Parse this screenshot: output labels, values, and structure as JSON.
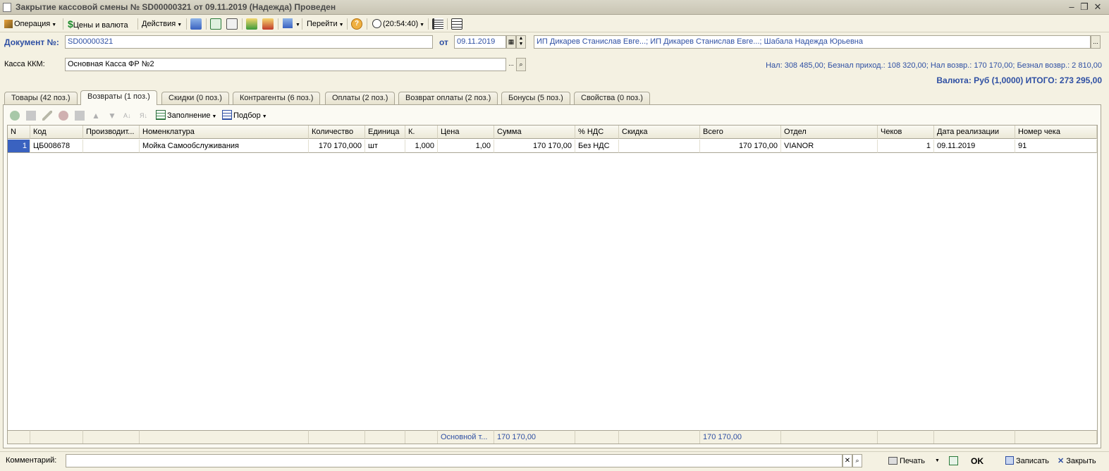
{
  "window": {
    "title": "Закрытие кассовой смены № SD00000321 от 09.11.2019 (Надежда) Проведен"
  },
  "toolbar": {
    "operation": "Операция",
    "prices_currency": "Цены и валюта",
    "actions": "Действия",
    "goto": "Перейти",
    "time": "(20:54:40)"
  },
  "doc": {
    "number_label": "Документ №:",
    "number_value": "SD00000321",
    "date_label": "от",
    "date_value": "09.11.2019",
    "org_value": "ИП Дикарев Станислав Евге...; ИП Дикарев Станислав Евге...; Шабала Надежда Юрьевна",
    "kkm_label": "Касса ККМ:",
    "kkm_value": "Основная Касса ФР №2",
    "totals_line": "Нал: 308 485,00; Безнал приход.: 108 320,00; Нал возвр.: 170 170,00; Безнал возвр.: 2 810,00",
    "currency_total": "Валюта: Руб (1,0000) ИТОГО: 273 295,00"
  },
  "tabs": [
    "Товары (42 поз.)",
    "Возвраты (1 поз.)",
    "Скидки (0 поз.)",
    "Контрагенты (6 поз.)",
    "Оплаты (2 поз.)",
    "Возврат оплаты (2 поз.)",
    "Бонусы (5 поз.)",
    "Свойства (0 поз.)"
  ],
  "grid_toolbar": {
    "fill": "Заполнение",
    "pick": "Подбор"
  },
  "table": {
    "columns": [
      "N",
      "Код",
      "Производит...",
      "Номенклатура",
      "Количество",
      "Единица",
      "К.",
      "Цена",
      "Сумма",
      "% НДС",
      "Скидка",
      "Всего",
      "Отдел",
      "Чеков",
      "Дата реализации",
      "Номер чека"
    ],
    "rows": [
      [
        "1",
        "ЦБ008678",
        "",
        "Мойка Самообслуживания",
        "170 170,000",
        "шт",
        "1,000",
        "1,00",
        "170 170,00",
        "Без НДС",
        "",
        "170 170,00",
        "VIANOR",
        "1",
        "09.11.2019",
        "91"
      ]
    ],
    "footer": {
      "price": "Основной т...",
      "sum": "170 170,00",
      "total": "170 170,00"
    }
  },
  "footer": {
    "comment_label": "Комментарий:",
    "comment_value": "",
    "print": "Печать",
    "ok": "OK",
    "save": "Записать",
    "close": "Закрыть"
  },
  "colors": {
    "accent": "#2e4fa3",
    "background": "#f4f1e2",
    "selection": "#3a62c0"
  }
}
